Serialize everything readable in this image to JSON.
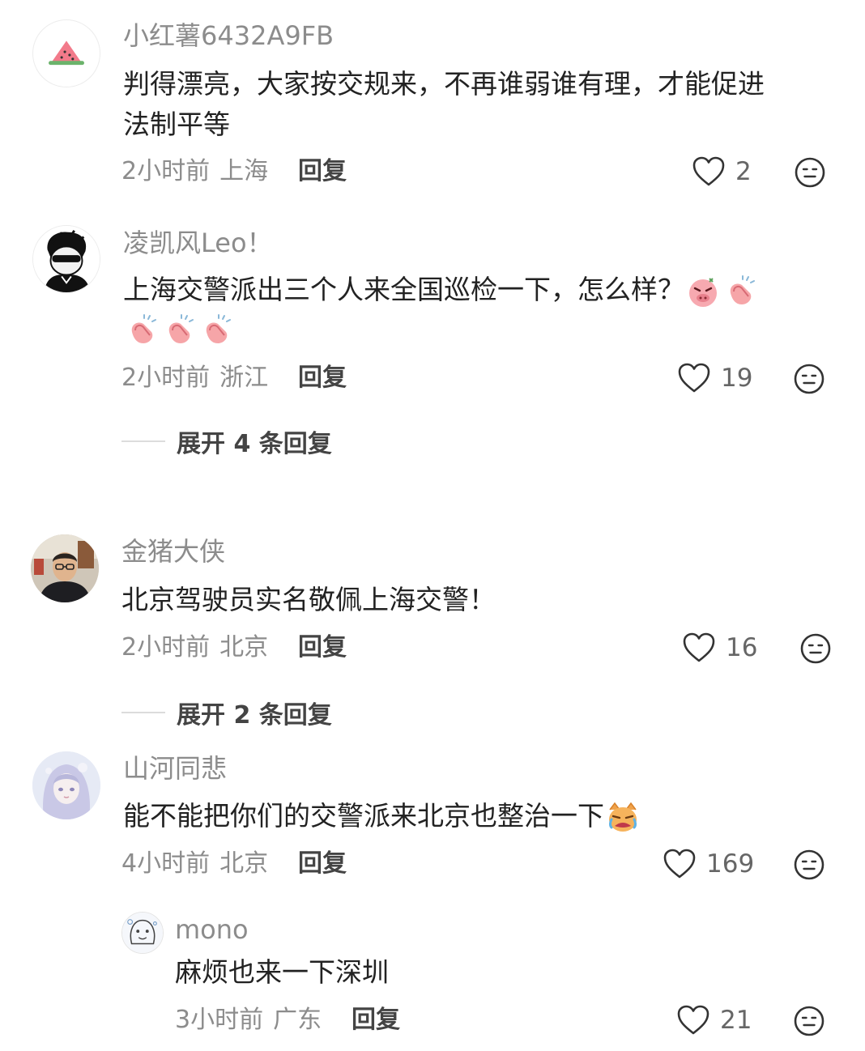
{
  "comments": [
    {
      "username": "小红薯6432A9FB",
      "text_line1": "判得漂亮，大家按交规来，不再谁弱谁有理，才能促进",
      "text_line2": "法制平等",
      "time": "2小时前",
      "location": "上海",
      "reply_label": "回复",
      "likes": "2",
      "avatar_icon": "watermelon-icon"
    },
    {
      "username": "凌凯风Leo！",
      "text_line1": "上海交警派出三个人来全国巡检一下，怎么样？",
      "text_line2": "",
      "time": "2小时前",
      "location": "浙江",
      "reply_label": "回复",
      "likes": "19",
      "avatar_icon": "cartoon-sunglasses-avatar",
      "expand_label": "展开 4 条回复"
    },
    {
      "username": "金猪大侠",
      "text_line1": "北京驾驶员实名敬佩上海交警！",
      "time": "2小时前",
      "location": "北京",
      "reply_label": "回复",
      "likes": "16",
      "avatar_icon": "person-photo-avatar",
      "expand_label": "展开 2 条回复"
    },
    {
      "username": "山河同悲",
      "text_line1": "能不能把你们的交警派来北京也整治一下",
      "time": "4小时前",
      "location": "北京",
      "reply_label": "回复",
      "likes": "169",
      "avatar_icon": "anime-girl-avatar"
    }
  ],
  "sub_reply": {
    "username": "mono",
    "text": "麻烦也来一下深圳",
    "time": "3小时前",
    "location": "广东",
    "reply_label": "回复",
    "likes": "21",
    "avatar_icon": "doodle-avatar"
  },
  "colors": {
    "meta_gray": "#8c8c8c",
    "text": "#222222",
    "icon_stroke": "#333333"
  }
}
